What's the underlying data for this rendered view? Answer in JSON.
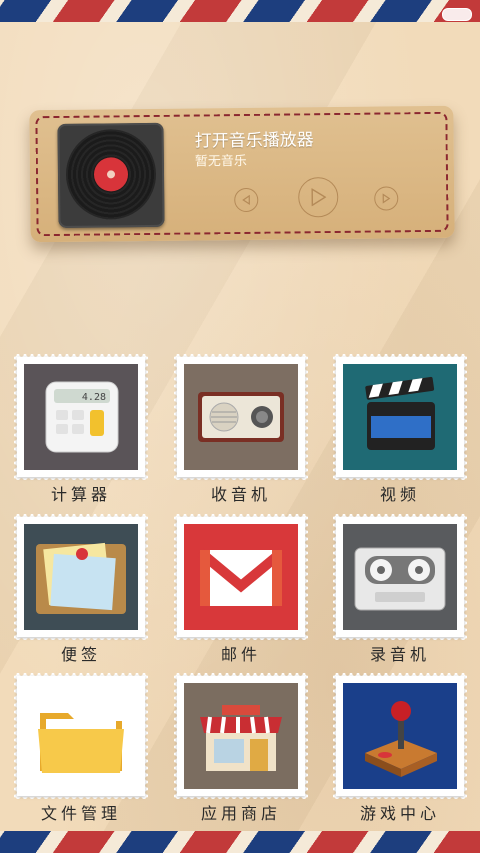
{
  "music": {
    "title": "打开音乐播放器",
    "subtitle": "暂无音乐"
  },
  "calculator_display": "4.28",
  "apps": [
    {
      "label": "计算器",
      "icon": "calculator-icon",
      "bg": "#5a5458"
    },
    {
      "label": "收音机",
      "icon": "radio-icon",
      "bg": "#7d6e62"
    },
    {
      "label": "视频",
      "icon": "video-clapper-icon",
      "bg": "#1f6a74"
    },
    {
      "label": "便签",
      "icon": "sticky-notes-icon",
      "bg": "#3e4d55"
    },
    {
      "label": "邮件",
      "icon": "mail-icon",
      "bg": "#d8383a"
    },
    {
      "label": "录音机",
      "icon": "cassette-icon",
      "bg": "#595b5e"
    },
    {
      "label": "文件管理",
      "icon": "folder-icon",
      "bg": "#ffffff"
    },
    {
      "label": "应用商店",
      "icon": "store-icon",
      "bg": "#7b6d60"
    },
    {
      "label": "游戏中心",
      "icon": "joystick-icon",
      "bg": "#1a3f8a"
    }
  ]
}
